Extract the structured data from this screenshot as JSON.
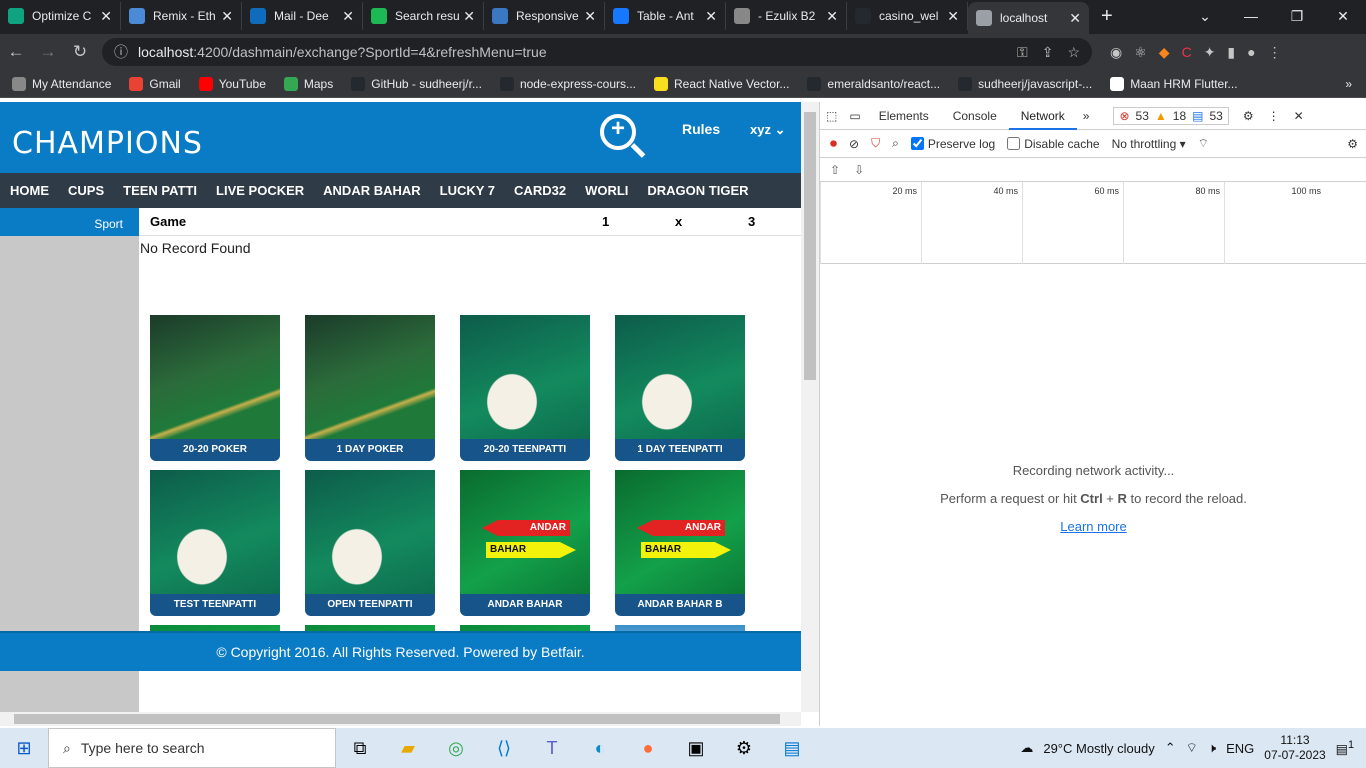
{
  "browser": {
    "tabs": [
      {
        "title": "Optimize C",
        "color": "#10a37f"
      },
      {
        "title": "Remix - Eth",
        "color": "#4b8ad6"
      },
      {
        "title": "Mail - Dee",
        "color": "#0f6cbd"
      },
      {
        "title": "Search resu",
        "color": "#1db954"
      },
      {
        "title": "Responsive",
        "color": "#3a78c2"
      },
      {
        "title": "Table - Ant",
        "color": "#1677ff"
      },
      {
        "title": "- Ezulix B2",
        "color": "#888888"
      },
      {
        "title": "casino_wel",
        "color": "#24292f"
      },
      {
        "title": "localhost",
        "color": "#9aa0a6"
      }
    ],
    "url_host": "localhost",
    "url_rest": ":4200/dashmain/exchange?SportId=4&refreshMenu=true",
    "bookmarks": [
      {
        "label": "My Attendance",
        "color": "#888888"
      },
      {
        "label": "Gmail",
        "color": "#ea4335"
      },
      {
        "label": "YouTube",
        "color": "#ff0000"
      },
      {
        "label": "Maps",
        "color": "#34a853"
      },
      {
        "label": "GitHub - sudheerj/r...",
        "color": "#24292f"
      },
      {
        "label": "node-express-cours...",
        "color": "#24292f"
      },
      {
        "label": "React Native Vector...",
        "color": "#f7df1e"
      },
      {
        "label": "emeraldsanto/react...",
        "color": "#24292f"
      },
      {
        "label": "sudheerj/javascript-...",
        "color": "#24292f"
      },
      {
        "label": "Maan HRM Flutter...",
        "color": "#ffffff"
      }
    ]
  },
  "site": {
    "logo": "CHAMPIONS",
    "rules": "Rules",
    "user": "xyz",
    "menu": [
      "HOME",
      "CUPS",
      "TEEN PATTI",
      "LIVE POCKER",
      "ANDAR BAHAR",
      "LUCKY 7",
      "CARD32",
      "WORLI",
      "DRAGON TIGER"
    ],
    "sport_label": "Sport",
    "table_headers": {
      "game": "Game",
      "c1": "1",
      "cx": "x",
      "c3": "3"
    },
    "no_record": "No Record Found",
    "games": [
      {
        "label": "20-20 POKER",
        "theme": "poker"
      },
      {
        "label": "1 DAY POKER",
        "theme": "poker"
      },
      {
        "label": "20-20 TEENPATTI",
        "theme": "teenpatti"
      },
      {
        "label": "1 DAY TEENPATTI",
        "theme": "teenpatti"
      },
      {
        "label": "TEST TEENPATTI",
        "theme": "teenpatti"
      },
      {
        "label": "OPEN TEENPATTI",
        "theme": "teenpatti"
      },
      {
        "label": "ANDAR BAHAR",
        "theme": "andar"
      },
      {
        "label": "ANDAR BAHAR B",
        "theme": "andar"
      },
      {
        "label": "",
        "theme": "green"
      },
      {
        "label": "",
        "theme": "green"
      },
      {
        "label": "",
        "theme": "green"
      },
      {
        "label": "",
        "theme": "live"
      }
    ],
    "andar_text": "ANDAR",
    "bahar_text": "BAHAR",
    "footer": "© Copyright 2016. All Rights Reserved. Powered by Betfair."
  },
  "devtools": {
    "tabs": [
      "Elements",
      "Console",
      "Network"
    ],
    "errors": "53",
    "warnings": "18",
    "messages": "53",
    "preserve_log": "Preserve log",
    "disable_cache": "Disable cache",
    "throttling": "No throttling",
    "ticks": [
      "20 ms",
      "40 ms",
      "60 ms",
      "80 ms",
      "100 ms"
    ],
    "empty_title": "Recording network activity...",
    "empty_hint_pre": "Perform a request or hit ",
    "empty_hint_ctrl": "Ctrl",
    "empty_hint_r": "R",
    "empty_hint_post": " to record the reload.",
    "learn_more": "Learn more"
  },
  "taskbar": {
    "search_placeholder": "Type here to search",
    "weather": "29°C  Mostly cloudy",
    "lang": "ENG",
    "time": "11:13",
    "date": "07-07-2023",
    "notif_count": "1"
  }
}
